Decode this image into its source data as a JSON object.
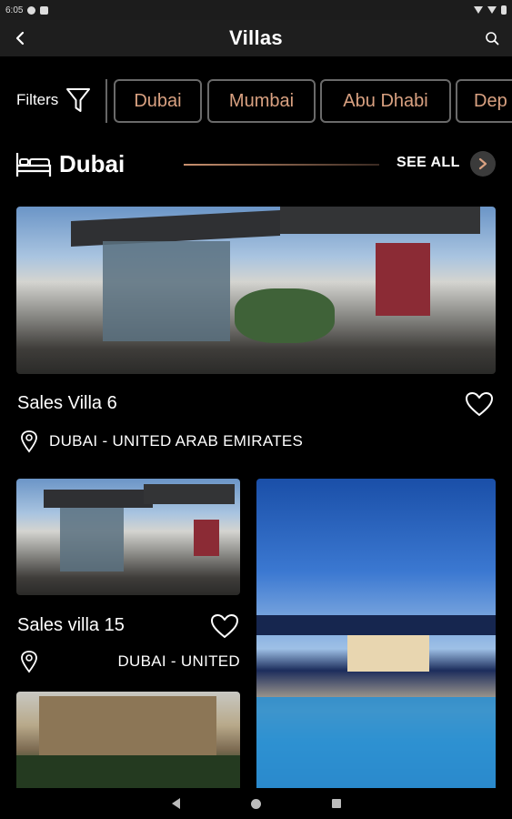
{
  "status_bar": {
    "time": "6:05"
  },
  "header": {
    "title": "Villas"
  },
  "filters": {
    "label": "Filters",
    "chips": [
      "Dubai",
      "Mumbai",
      "Abu Dhabi",
      "Dep"
    ]
  },
  "section": {
    "title": "Dubai",
    "see_all": "SEE ALL"
  },
  "cards": [
    {
      "title": "Sales Villa 6",
      "location": "DUBAI - UNITED ARAB EMIRATES"
    },
    {
      "title": "Sales villa 15",
      "location": "DUBAI - UNITED"
    }
  ],
  "colors": {
    "accent": "#d9a181",
    "background": "#000000",
    "appbar": "#1e1e1e"
  }
}
